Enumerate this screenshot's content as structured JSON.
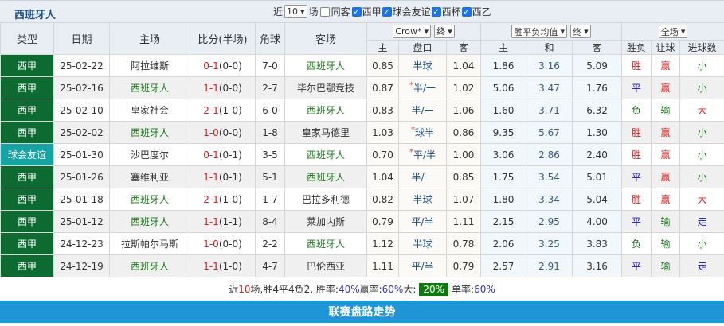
{
  "header": {
    "team": "西班牙人",
    "recent_label": "近",
    "recent_count": "10",
    "games_label": "场",
    "same_label": "同客",
    "filters": [
      {
        "label": "西甲",
        "checked": true
      },
      {
        "label": "球会友谊",
        "checked": true
      },
      {
        "label": "西杯",
        "checked": true
      },
      {
        "label": "西乙",
        "checked": true
      }
    ]
  },
  "columns": {
    "type": "类型",
    "date": "日期",
    "home": "主场",
    "score": "比分(半场)",
    "corner": "角球",
    "away": "客场",
    "company": "Crow*",
    "odds_stage": "终",
    "avg": "胜平负均值",
    "avg_stage": "终",
    "scope": "全场",
    "sub": [
      "主",
      "盘口",
      "客",
      "主",
      "和",
      "客",
      "胜负",
      "让球",
      "进球数"
    ]
  },
  "rows": [
    {
      "type": "西甲",
      "date": "25-02-22",
      "home": "阿拉维斯",
      "ft": "0-1",
      "ht": "(0-0)",
      "corner": "7-0",
      "away": "西班牙人",
      "h": "0.85",
      "hc": "半球",
      "star": false,
      "a": "1.04",
      "w": "1.86",
      "d": "3.16",
      "l": "5.09",
      "r": "胜",
      "ah": "赢",
      "ou": "小"
    },
    {
      "type": "西甲",
      "date": "25-02-16",
      "home": "西班牙人",
      "ft": "1-1",
      "ht": "(0-0)",
      "corner": "2-7",
      "away": "毕尔巴鄂竞技",
      "h": "0.87",
      "hc": "半/一",
      "star": true,
      "a": "1.02",
      "w": "5.06",
      "d": "3.47",
      "l": "1.76",
      "r": "平",
      "ah": "赢",
      "ou": "小"
    },
    {
      "type": "西甲",
      "date": "25-02-10",
      "home": "皇家社会",
      "ft": "2-1",
      "ht": "(1-0)",
      "corner": "6-0",
      "away": "西班牙人",
      "h": "0.83",
      "hc": "半/一",
      "star": false,
      "a": "1.06",
      "w": "1.60",
      "d": "3.71",
      "l": "6.32",
      "r": "负",
      "ah": "输",
      "ou": "大"
    },
    {
      "type": "西甲",
      "date": "25-02-02",
      "home": "西班牙人",
      "ft": "1-0",
      "ht": "(0-0)",
      "corner": "1-8",
      "away": "皇家马德里",
      "h": "1.03",
      "hc": "球半",
      "star": true,
      "a": "0.86",
      "w": "9.35",
      "d": "5.67",
      "l": "1.30",
      "r": "胜",
      "ah": "赢",
      "ou": "小"
    },
    {
      "type": "球会友谊",
      "date": "25-01-30",
      "home": "沙巴度尔",
      "ft": "0-1",
      "ht": "(0-1)",
      "corner": "3-5",
      "away": "西班牙人",
      "h": "0.70",
      "hc": "平/半",
      "star": true,
      "a": "1.00",
      "w": "3.06",
      "d": "2.86",
      "l": "2.40",
      "r": "胜",
      "ah": "赢",
      "ou": "小"
    },
    {
      "type": "西甲",
      "date": "25-01-26",
      "home": "塞维利亚",
      "ft": "1-1",
      "ht": "(0-1)",
      "corner": "5-1",
      "away": "西班牙人",
      "h": "1.04",
      "hc": "半/一",
      "star": false,
      "a": "0.85",
      "w": "1.75",
      "d": "3.54",
      "l": "5.01",
      "r": "平",
      "ah": "赢",
      "ou": "小"
    },
    {
      "type": "西甲",
      "date": "25-01-18",
      "home": "西班牙人",
      "ft": "2-1",
      "ht": "(1-0)",
      "corner": "1-7",
      "away": "巴拉多利德",
      "h": "0.82",
      "hc": "半球",
      "star": false,
      "a": "1.07",
      "w": "1.80",
      "d": "3.34",
      "l": "5.04",
      "r": "胜",
      "ah": "赢",
      "ou": "大"
    },
    {
      "type": "西甲",
      "date": "25-01-12",
      "home": "西班牙人",
      "ft": "1-1",
      "ht": "(1-1)",
      "corner": "8-4",
      "away": "莱加内斯",
      "h": "0.79",
      "hc": "平/半",
      "star": false,
      "a": "1.11",
      "w": "2.15",
      "d": "2.95",
      "l": "4.00",
      "r": "平",
      "ah": "输",
      "ou": "走"
    },
    {
      "type": "西甲",
      "date": "24-12-23",
      "home": "拉斯帕尔马斯",
      "ft": "1-0",
      "ht": "(0-0)",
      "corner": "2-2",
      "away": "西班牙人",
      "h": "1.12",
      "hc": "半球",
      "star": false,
      "a": "0.78",
      "w": "2.06",
      "d": "3.25",
      "l": "3.83",
      "r": "负",
      "ah": "输",
      "ou": "小"
    },
    {
      "type": "西甲",
      "date": "24-12-19",
      "home": "西班牙人",
      "ft": "1-1",
      "ht": "(1-0)",
      "corner": "4-7",
      "away": "巴伦西亚",
      "h": "1.11",
      "hc": "平/半",
      "star": false,
      "a": "0.79",
      "w": "2.57",
      "d": "2.91",
      "l": "3.16",
      "r": "平",
      "ah": "输",
      "ou": "走"
    }
  ],
  "summary": {
    "p1": "近",
    "games": "10",
    "p2": "场,胜4平4负2, 胜率:",
    "win_rate": "40%",
    "p3": " 赢率:",
    "cover_rate": "60%",
    "p4": " 大:",
    "over_rate": "20%",
    "p5": " 单率:",
    "odd_rate": "60%"
  },
  "footer": {
    "label": "联赛盘路走势"
  }
}
